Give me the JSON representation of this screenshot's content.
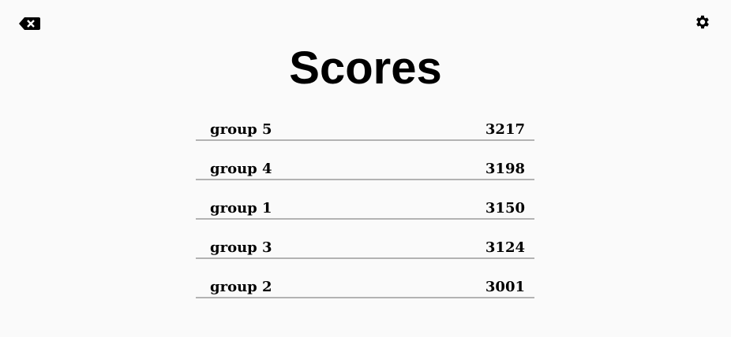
{
  "title": "Scores",
  "icons": {
    "back": "backspace-icon",
    "settings": "gear-icon"
  },
  "scores": [
    {
      "name": "group 5",
      "score": "3217"
    },
    {
      "name": "group 4",
      "score": "3198"
    },
    {
      "name": "group 1",
      "score": "3150"
    },
    {
      "name": "group 3",
      "score": "3124"
    },
    {
      "name": "group 2",
      "score": "3001"
    }
  ]
}
